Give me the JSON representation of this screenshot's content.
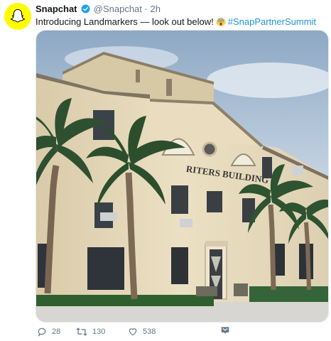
{
  "tweet": {
    "author_name": "Snapchat",
    "handle": "@Snapchat",
    "separator": "·",
    "time": "2h",
    "text_before": "Introducing Landmarkers — look out below!",
    "hashtag": "#SnapPartnerSummit",
    "verified_icon": "verified-badge-icon",
    "emoji_icon": "scream-emoji-icon"
  },
  "media": {
    "sign_text": "RITERS BUILDING",
    "description_icon": "building-photo"
  },
  "actions": {
    "reply_count": "28",
    "retweet_count": "130",
    "like_count": "538"
  },
  "colors": {
    "snapchat_yellow": "#fffc00",
    "link_blue": "#1b95e0",
    "meta_gray": "#657786",
    "building_cream": "#e7d9bd"
  }
}
